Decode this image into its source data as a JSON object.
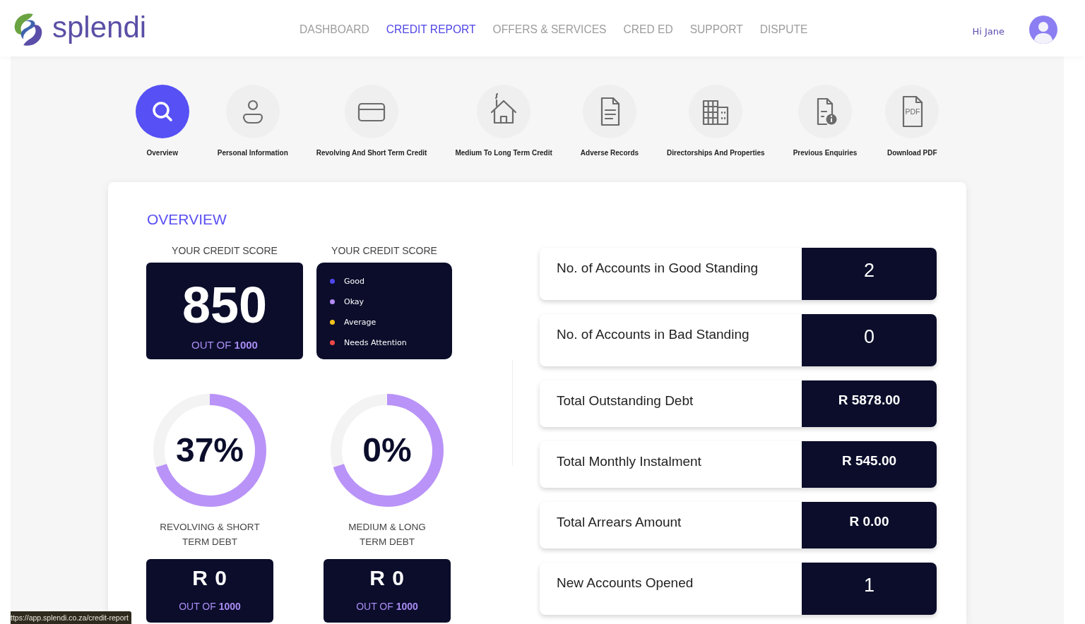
{
  "header": {
    "logo": {
      "text": "splendi"
    },
    "nav": [
      {
        "label": "DASHBOARD",
        "selected": false
      },
      {
        "label": "CREDIT REPORT",
        "selected": true
      },
      {
        "label": "OFFERS & SERVICES",
        "selected": false
      },
      {
        "label": "CRED ED",
        "selected": false
      },
      {
        "label": "SUPPORT",
        "selected": false
      },
      {
        "label": "DISPUTE",
        "selected": false
      }
    ],
    "greeting": "Hi Jane"
  },
  "report_tabs": [
    {
      "label": "Overview",
      "selected": true
    },
    {
      "label": "Personal Information",
      "selected": false
    },
    {
      "label": "Revolving And Short Term Credit",
      "selected": false
    },
    {
      "label": "Medium To Long Term Credit",
      "selected": false
    },
    {
      "label": "Adverse Records",
      "selected": false
    },
    {
      "label": "Directorships And Properties",
      "selected": false
    },
    {
      "label": "Previous Enquiries",
      "selected": false
    },
    {
      "label": "Download PDF",
      "selected": false,
      "icon_text": "PDF"
    }
  ],
  "overview": {
    "title": "OVERVIEW",
    "credit_score": {
      "heading": "YOUR CREDIT SCORE",
      "score": "850",
      "out_of": "OUT OF **1000**"
    },
    "legend": {
      "heading": "YOUR CREDIT SCORE",
      "items": [
        {
          "label": "Good",
          "color": "#4f46ee"
        },
        {
          "label": "Okay",
          "color": "#b38cf7"
        },
        {
          "label": "Average",
          "color": "#f6c21c"
        },
        {
          "label": "Needs Attention",
          "color": "#f04848"
        }
      ]
    },
    "debt_gauges": [
      {
        "percent": "37%",
        "level": 0.7,
        "label": "REVOLVING & SHORT TERM DEBT",
        "amount": "R 0",
        "out_of": "OUT OF **1000**"
      },
      {
        "percent": "0%",
        "level": 0.7,
        "label": "MEDIUM & LONG TERM DEBT",
        "amount": "R 0",
        "out_of": "OUT OF **1000**"
      }
    ],
    "stats": [
      {
        "label": "No. of Accounts in Good Standing",
        "value": "2",
        "kind": "count"
      },
      {
        "label": "No. of Accounts in Bad Standing",
        "value": "0",
        "kind": "count"
      },
      {
        "label": "Total Outstanding Debt",
        "value": "R 5878.00",
        "kind": "amount"
      },
      {
        "label": "Total Monthly Instalment",
        "value": "R 545.00",
        "kind": "amount"
      },
      {
        "label": "Total Arrears Amount",
        "value": "R 0.00",
        "kind": "amount"
      },
      {
        "label": "New Accounts Opened",
        "value": "1",
        "kind": "count"
      }
    ]
  },
  "status_bar": {
    "url": "ttps://app.splendi.co.za/credit-report"
  }
}
